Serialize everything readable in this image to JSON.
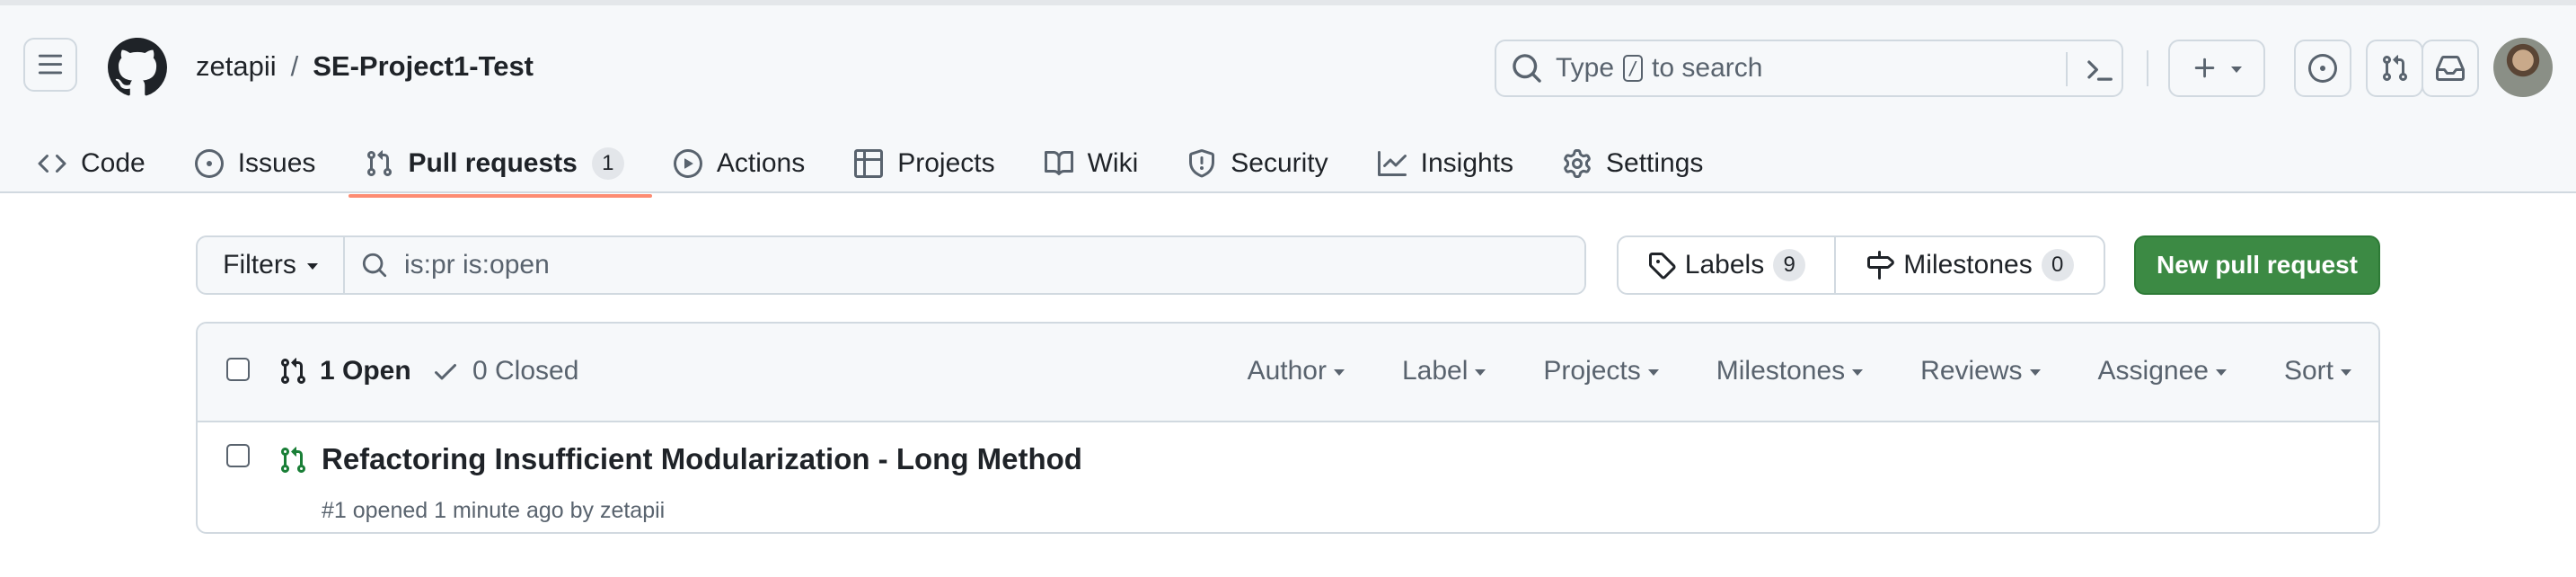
{
  "header": {
    "owner": "zetapii",
    "separator": "/",
    "repo": "SE-Project1-Test",
    "search": {
      "prefix": "Type",
      "key": "/",
      "suffix": "to search"
    }
  },
  "tabs": [
    {
      "label": "Code",
      "icon": "code-icon"
    },
    {
      "label": "Issues",
      "icon": "issue-opened-icon"
    },
    {
      "label": "Pull requests",
      "icon": "git-pull-request-icon",
      "count": "1",
      "active": true
    },
    {
      "label": "Actions",
      "icon": "play-icon"
    },
    {
      "label": "Projects",
      "icon": "table-icon"
    },
    {
      "label": "Wiki",
      "icon": "book-icon"
    },
    {
      "label": "Security",
      "icon": "shield-icon"
    },
    {
      "label": "Insights",
      "icon": "graph-icon"
    },
    {
      "label": "Settings",
      "icon": "gear-icon"
    }
  ],
  "subnav": {
    "filters_label": "Filters",
    "query": "is:pr is:open",
    "labels_label": "Labels",
    "labels_count": "9",
    "milestones_label": "Milestones",
    "milestones_count": "0",
    "new_pr_label": "New pull request"
  },
  "list": {
    "open_label": "1 Open",
    "closed_label": "0 Closed",
    "sort_menus": [
      "Author",
      "Label",
      "Projects",
      "Milestones",
      "Reviews",
      "Assignee",
      "Sort"
    ],
    "items": [
      {
        "title": "Refactoring Insufficient Modularization - Long Method",
        "meta": "#1 opened 1 minute ago by zetapii"
      }
    ]
  },
  "colors": {
    "accent_underline": "#fd8c73",
    "primary_button": "#3c8a44",
    "open_icon": "#1a7f37"
  }
}
